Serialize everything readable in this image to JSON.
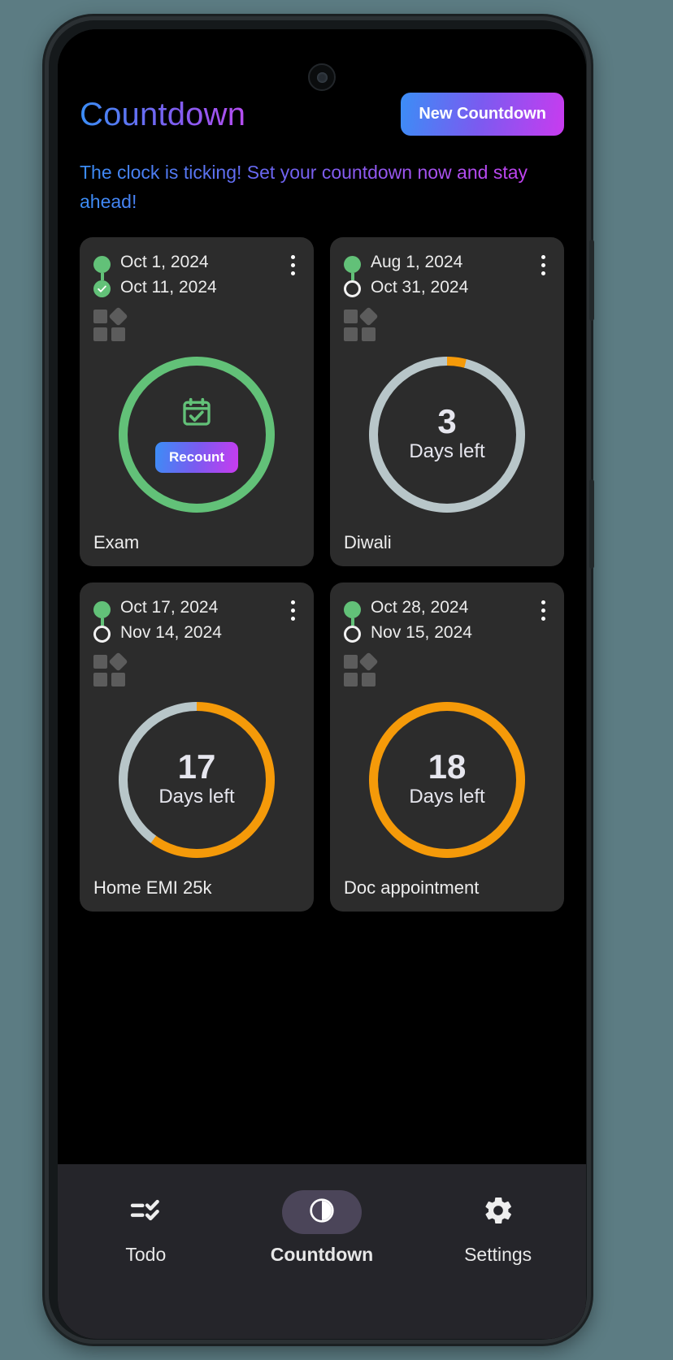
{
  "header": {
    "title": "Countdown",
    "new_button_label": "New Countdown",
    "subtitle": "The clock is ticking! Set your countdown now and stay ahead!"
  },
  "colors": {
    "accent_gradient_start": "#3b8ef6",
    "accent_gradient_mid": "#7a5bf0",
    "accent_gradient_end": "#c93bef",
    "progress_orange": "#f59a09",
    "progress_track": "#b8c6c9",
    "complete_green": "#62c178",
    "card_background": "#2c2c2c",
    "screen_background": "#000000",
    "nav_background": "#25252a",
    "nav_active_pill": "#4b4559"
  },
  "cards": [
    {
      "start_date": "Oct 1, 2024",
      "end_date": "Oct 11, 2024",
      "title": "Exam",
      "status": "completed",
      "end_marker": "check-circle",
      "category_icon": "category-grid-icon",
      "menu_icon": "kebab-menu-icon",
      "ring_color": "#62c178",
      "progress_percent": 100,
      "center_icon": "calendar-check-icon",
      "recount_label": "Recount"
    },
    {
      "start_date": "Aug 1, 2024",
      "end_date": "Oct 31, 2024",
      "title": "Diwali",
      "status": "active",
      "end_marker": "open-circle",
      "category_icon": "category-grid-icon",
      "menu_icon": "kebab-menu-icon",
      "days_number": "3",
      "days_label": "Days left",
      "progress_percent": 4,
      "ring_color": "#f59a09",
      "track_color": "#b8c6c9"
    },
    {
      "start_date": "Oct 17, 2024",
      "end_date": "Nov 14, 2024",
      "title": "Home EMI 25k",
      "status": "active",
      "end_marker": "open-circle",
      "category_icon": "category-grid-icon",
      "menu_icon": "kebab-menu-icon",
      "days_number": "17",
      "days_label": "Days left",
      "progress_percent": 60,
      "ring_color": "#f59a09",
      "track_color": "#b8c6c9"
    },
    {
      "start_date": "Oct 28, 2024",
      "end_date": "Nov 15, 2024",
      "title": "Doc appointment",
      "status": "active",
      "end_marker": "open-circle",
      "category_icon": "category-grid-icon",
      "menu_icon": "kebab-menu-icon",
      "days_number": "18",
      "days_label": "Days left",
      "progress_percent": 100,
      "ring_color": "#f59a09",
      "track_color": "#b8c6c9"
    }
  ],
  "bottom_nav": {
    "items": [
      {
        "label": "Todo",
        "icon": "todo-checklist-icon",
        "active": false
      },
      {
        "label": "Countdown",
        "icon": "countdown-clock-icon",
        "active": true
      },
      {
        "label": "Settings",
        "icon": "gear-icon",
        "active": false
      }
    ]
  }
}
